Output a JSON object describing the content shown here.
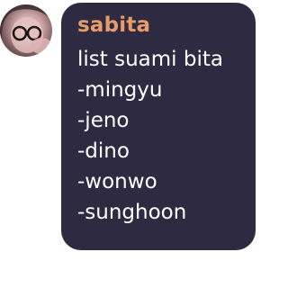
{
  "message": {
    "sender": "sabita",
    "lines": [
      "list suami bita",
      "-mingyu",
      "-jeno",
      "-dino",
      "-wonwo",
      "-sunghoon"
    ]
  },
  "avatar": {
    "icon": "profile-photo"
  },
  "colors": {
    "bubble_background": "#2d2a42",
    "sender_name": "#e79b66",
    "message_text": "#ffffff"
  }
}
